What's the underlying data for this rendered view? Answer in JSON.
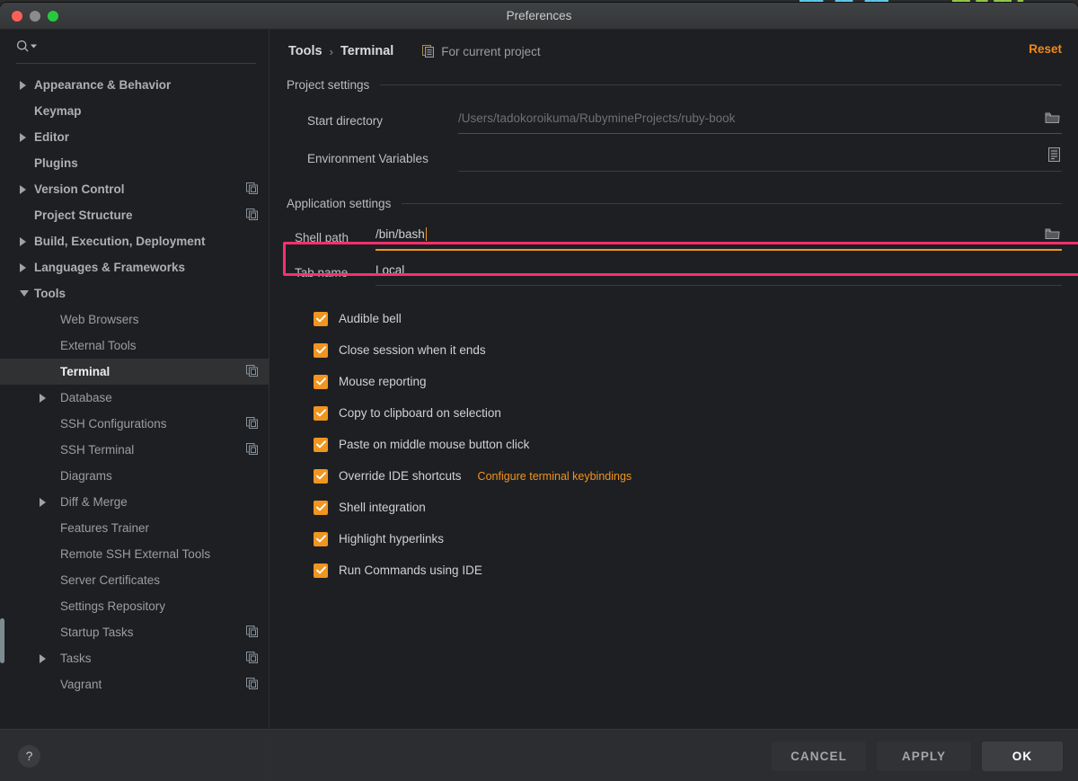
{
  "window": {
    "title": "Preferences",
    "traffic_lights": [
      "close-red",
      "minimize-gray",
      "zoom-green"
    ]
  },
  "colors": {
    "accent_orange": "#f0951f",
    "highlight_pink": "#fb2f6e",
    "panel_bg": "#1e1f22",
    "titlebar_bg": "#3c3f41",
    "selected_row": "#2f3133",
    "text_primary": "#cfd1d3",
    "text_muted": "#9b9d9f"
  },
  "sidebar": {
    "search": {
      "value": "",
      "placeholder": ""
    },
    "items": [
      {
        "label": "Appearance & Behavior",
        "level": 0,
        "arrow": "right",
        "copy_icon": false,
        "selected": false
      },
      {
        "label": "Keymap",
        "level": 0,
        "arrow": "none",
        "copy_icon": false,
        "selected": false
      },
      {
        "label": "Editor",
        "level": 0,
        "arrow": "right",
        "copy_icon": false,
        "selected": false
      },
      {
        "label": "Plugins",
        "level": 0,
        "arrow": "none",
        "copy_icon": false,
        "selected": false
      },
      {
        "label": "Version Control",
        "level": 0,
        "arrow": "right",
        "copy_icon": true,
        "selected": false
      },
      {
        "label": "Project Structure",
        "level": 0,
        "arrow": "none",
        "copy_icon": true,
        "selected": false
      },
      {
        "label": "Build, Execution, Deployment",
        "level": 0,
        "arrow": "right",
        "copy_icon": false,
        "selected": false
      },
      {
        "label": "Languages & Frameworks",
        "level": 0,
        "arrow": "right",
        "copy_icon": false,
        "selected": false
      },
      {
        "label": "Tools",
        "level": 0,
        "arrow": "down",
        "copy_icon": false,
        "selected": false
      },
      {
        "label": "Web Browsers",
        "level": 1,
        "arrow": "none",
        "copy_icon": false,
        "selected": false
      },
      {
        "label": "External Tools",
        "level": 1,
        "arrow": "none",
        "copy_icon": false,
        "selected": false
      },
      {
        "label": "Terminal",
        "level": 1,
        "arrow": "none",
        "copy_icon": true,
        "selected": true
      },
      {
        "label": "Database",
        "level": 1,
        "arrow": "right",
        "copy_icon": false,
        "selected": false
      },
      {
        "label": "SSH Configurations",
        "level": 1,
        "arrow": "none",
        "copy_icon": true,
        "selected": false
      },
      {
        "label": "SSH Terminal",
        "level": 1,
        "arrow": "none",
        "copy_icon": true,
        "selected": false
      },
      {
        "label": "Diagrams",
        "level": 1,
        "arrow": "none",
        "copy_icon": false,
        "selected": false
      },
      {
        "label": "Diff & Merge",
        "level": 1,
        "arrow": "right",
        "copy_icon": false,
        "selected": false
      },
      {
        "label": "Features Trainer",
        "level": 1,
        "arrow": "none",
        "copy_icon": false,
        "selected": false
      },
      {
        "label": "Remote SSH External Tools",
        "level": 1,
        "arrow": "none",
        "copy_icon": false,
        "selected": false
      },
      {
        "label": "Server Certificates",
        "level": 1,
        "arrow": "none",
        "copy_icon": false,
        "selected": false
      },
      {
        "label": "Settings Repository",
        "level": 1,
        "arrow": "none",
        "copy_icon": false,
        "selected": false
      },
      {
        "label": "Startup Tasks",
        "level": 1,
        "arrow": "none",
        "copy_icon": true,
        "selected": false
      },
      {
        "label": "Tasks",
        "level": 1,
        "arrow": "right",
        "copy_icon": true,
        "selected": false
      },
      {
        "label": "Vagrant",
        "level": 1,
        "arrow": "none",
        "copy_icon": true,
        "selected": false
      }
    ],
    "help_label": "?"
  },
  "header": {
    "breadcrumb": [
      "Tools",
      "Terminal"
    ],
    "breadcrumb_separator": "›",
    "scope_label": "For current project",
    "reset_label": "Reset"
  },
  "project_settings": {
    "section_title": "Project settings",
    "start_directory": {
      "label": "Start directory",
      "value": "",
      "placeholder": "/Users/tadokoroikuma/RubymineProjects/ruby-book"
    },
    "environment_variables": {
      "label": "Environment Variables",
      "value": ""
    }
  },
  "application_settings": {
    "section_title": "Application settings",
    "shell_path": {
      "label": "Shell path",
      "value": "/bin/bash",
      "focused": true,
      "highlighted": true
    },
    "tab_name": {
      "label": "Tab name",
      "value": "Local"
    },
    "checkboxes": [
      {
        "label": "Audible bell",
        "checked": true
      },
      {
        "label": "Close session when it ends",
        "checked": true
      },
      {
        "label": "Mouse reporting",
        "checked": true
      },
      {
        "label": "Copy to clipboard on selection",
        "checked": true
      },
      {
        "label": "Paste on middle mouse button click",
        "checked": true
      },
      {
        "label": "Override IDE shortcuts",
        "checked": true,
        "link": "Configure terminal keybindings"
      },
      {
        "label": "Shell integration",
        "checked": true
      },
      {
        "label": "Highlight hyperlinks",
        "checked": true
      },
      {
        "label": "Run Commands using IDE",
        "checked": true
      }
    ]
  },
  "footer": {
    "cancel_label": "CANCEL",
    "apply_label": "APPLY",
    "ok_label": "OK"
  }
}
